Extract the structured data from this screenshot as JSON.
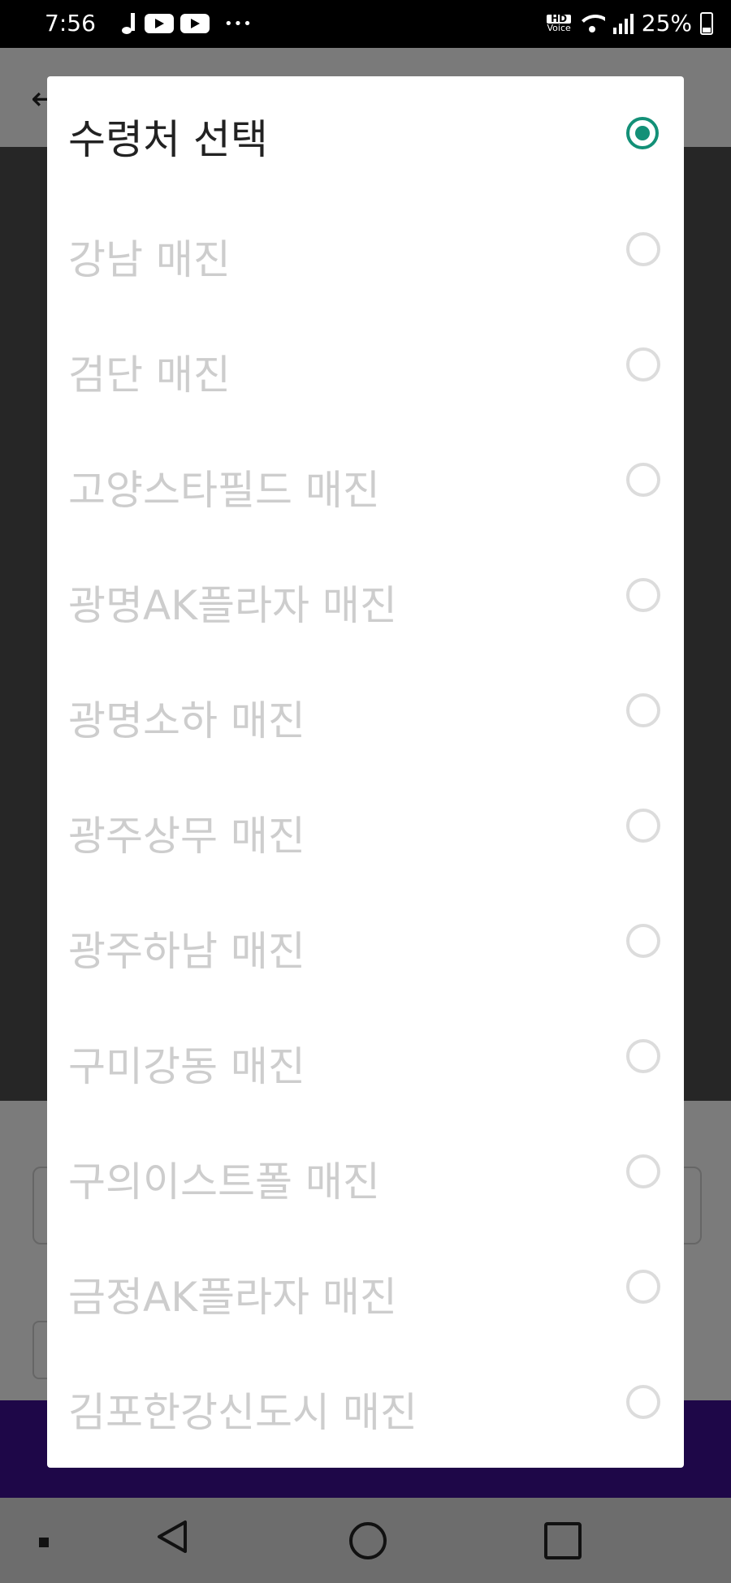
{
  "status_bar": {
    "time": "7:56",
    "hd_label": "HD",
    "voice_label": "Voice",
    "battery": "25%"
  },
  "background": {
    "back_arrow": "←"
  },
  "dialog": {
    "title": "수령처 선택",
    "accent_color": "#139077",
    "options": [
      {
        "label": "강남 매진"
      },
      {
        "label": "검단 매진"
      },
      {
        "label": "고양스타필드 매진"
      },
      {
        "label": "광명AK플라자 매진"
      },
      {
        "label": "광명소하 매진"
      },
      {
        "label": "광주상무 매진"
      },
      {
        "label": "광주하남 매진"
      },
      {
        "label": "구미강동 매진"
      },
      {
        "label": "구의이스트폴 매진"
      },
      {
        "label": "금정AK플라자 매진"
      },
      {
        "label": "김포한강신도시 매진"
      }
    ]
  }
}
